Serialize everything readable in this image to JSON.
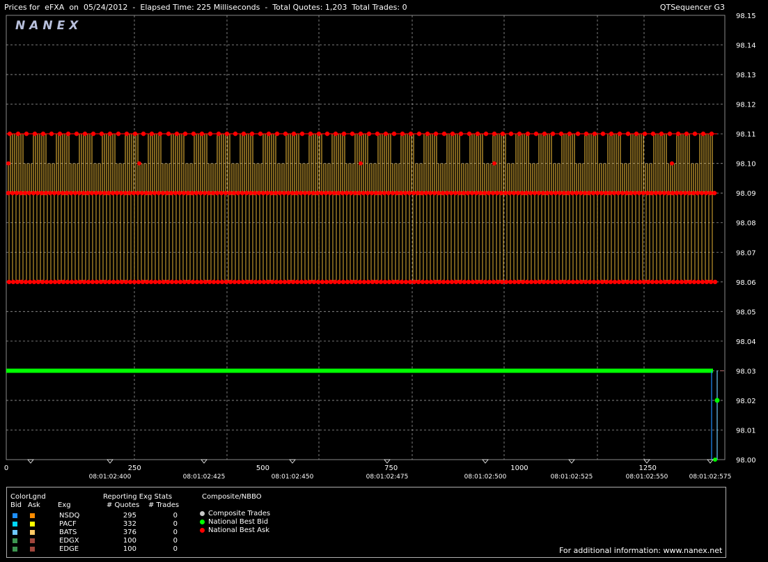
{
  "header": {
    "title": "Prices for  eFXA  on  05/24/2012  -  Elapsed Time: 225 Milliseconds  -  Total Quotes: 1,203  Total Trades: 0",
    "app": "QTSequencer G3",
    "logo": "NANEX"
  },
  "chart_data": {
    "type": "line",
    "title": "",
    "y_ticks": [
      "98.15",
      "98.14",
      "98.13",
      "98.12",
      "98.11",
      "98.10",
      "98.09",
      "98.08",
      "98.07",
      "98.06",
      "98.05",
      "98.04",
      "98.03",
      "98.02",
      "98.01",
      "98.00"
    ],
    "ylim": [
      98.0,
      98.15
    ],
    "x_count_ticks": [
      "0",
      "250",
      "500",
      "750",
      "1000",
      "1250"
    ],
    "xlim_count": [
      0,
      1380
    ],
    "time_ticks": [
      "08:01:02:400",
      "08:01:02:425",
      "08:01:02:450",
      "08:01:02:475",
      "08:01:02:500",
      "08:01:02:525",
      "08:01:02:550",
      "08:01:02:575"
    ],
    "grid": true,
    "series": [
      {
        "name": "National Best Ask",
        "color": "#ff0000",
        "levels": [
          98.06,
          98.09,
          98.1,
          98.11
        ]
      },
      {
        "name": "National Best Bid",
        "color": "#00ff00",
        "values_start": 98.03,
        "values_end": 98.02,
        "levels": [
          98.03,
          98.02,
          98.0
        ]
      }
    ],
    "ask_quote_band": {
      "low": 98.06,
      "high": 98.11,
      "color": "#ffc83c"
    }
  },
  "legend": {
    "color_legend_title": "ColorLgnd",
    "bid_label": "Bid",
    "ask_label": "Ask",
    "exg_label": "Exg",
    "stats_title": "Reporting Exg Stats",
    "quotes_label": "# Quotes",
    "trades_label": "# Trades",
    "exchanges": [
      {
        "exg": "NSDQ",
        "quotes": "295",
        "trades": "0",
        "bid_color": "#1e90ff",
        "ask_color": "#ff8c00"
      },
      {
        "exg": "PACF",
        "quotes": "332",
        "trades": "0",
        "bid_color": "#00d8ff",
        "ask_color": "#ffff00"
      },
      {
        "exg": "BATS",
        "quotes": "376",
        "trades": "0",
        "bid_color": "#6ec8ff",
        "ask_color": "#ffc864"
      },
      {
        "exg": "EDGX",
        "quotes": "100",
        "trades": "0",
        "bid_color": "#3c9650",
        "ask_color": "#a0463c"
      },
      {
        "exg": "EDGE",
        "quotes": "100",
        "trades": "0",
        "bid_color": "#3c9650",
        "ask_color": "#a0463c"
      }
    ],
    "composite_title": "Composite/NBBO",
    "composite_items": [
      {
        "label": "Composite Trades",
        "color": "#c8c8c8"
      },
      {
        "label": "National Best Bid",
        "color": "#00ff00"
      },
      {
        "label": "National Best Ask",
        "color": "#ff0000"
      }
    ],
    "footer": "For additional information: www.nanex.net"
  }
}
